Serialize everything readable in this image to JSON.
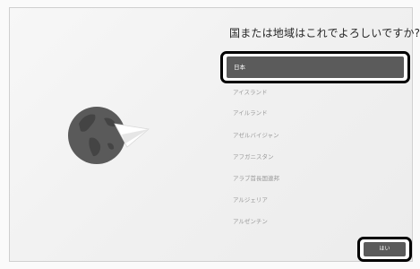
{
  "question": "国または地域はこれでよろしいですか?",
  "selected_item": "日本",
  "items": [
    "アイスランド",
    "アイルランド",
    "アゼルバイジャン",
    "アフガニスタン",
    "アラブ首長国連邦",
    "アルジェリア",
    "アルゼンチン"
  ],
  "yes_button": "はい",
  "icons": {
    "globe": "globe-icon",
    "paper_plane": "paper-plane-icon"
  },
  "colors": {
    "selected_bg": "#5b5b5b",
    "highlight_border": "#000000",
    "globe": "#5a5a5a"
  }
}
